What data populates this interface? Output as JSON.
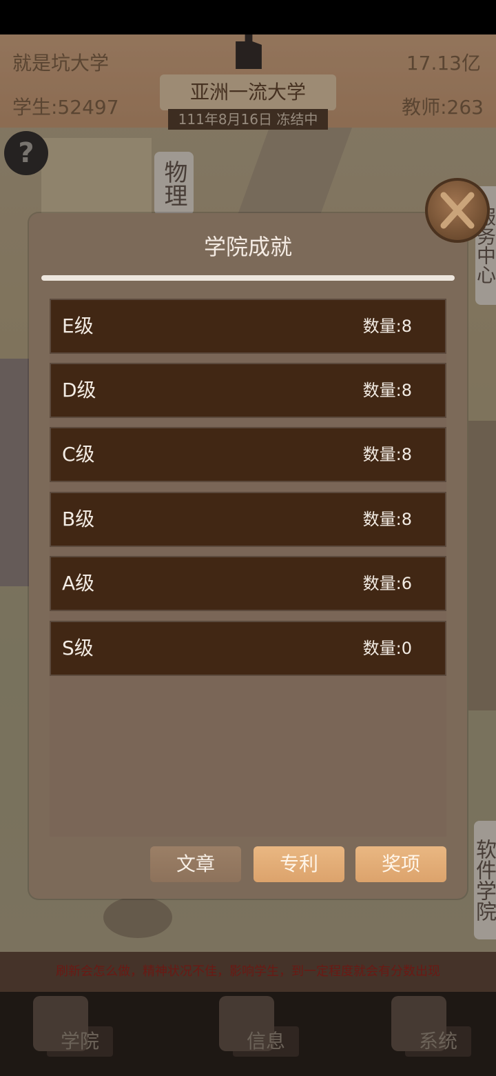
{
  "header": {
    "university_name": "就是坑大学",
    "money": "17.13亿",
    "students": "学生:52497",
    "teachers": "教师:263",
    "rank_title": "亚洲一流大学",
    "date_status": "111年8月16日 冻结中"
  },
  "scene_signs": {
    "physics": "物理",
    "service_center": "服务中心",
    "software_college": "软件学院"
  },
  "dialog": {
    "title": "学院成就",
    "rows": [
      {
        "label": "E级",
        "count": "数量:8"
      },
      {
        "label": "D级",
        "count": "数量:8"
      },
      {
        "label": "C级",
        "count": "数量:8"
      },
      {
        "label": "B级",
        "count": "数量:8"
      },
      {
        "label": "A级",
        "count": "数量:6"
      },
      {
        "label": "S级",
        "count": "数量:0"
      }
    ],
    "tabs": {
      "article": "文章",
      "patent": "专利",
      "award": "奖项"
    }
  },
  "notice_text": "刷新会怎么做，精神状况不佳，影响学生，到一定程度就会有分数出现",
  "bottom_nav": {
    "college": "学院",
    "info": "信息",
    "system": "系统"
  },
  "icons": {
    "help": "help-icon",
    "close": "close-icon",
    "building": "building-icon"
  }
}
